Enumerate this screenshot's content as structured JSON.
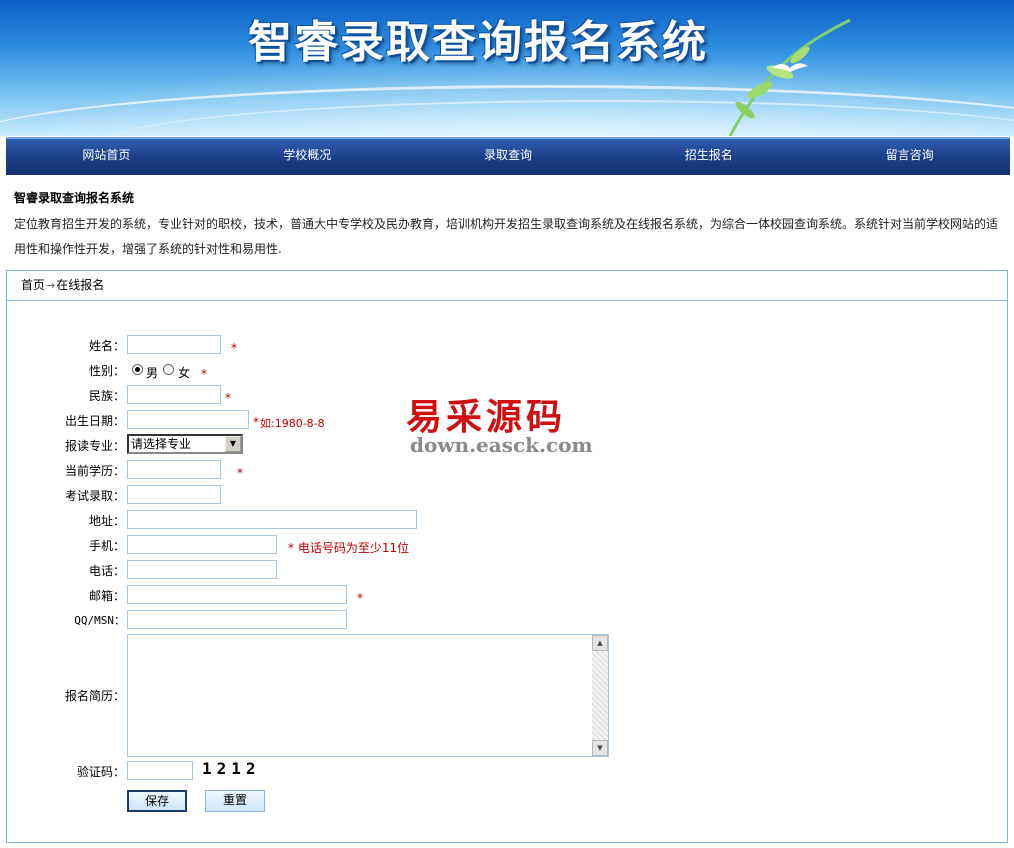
{
  "header": {
    "title": "智睿录取查询报名系统"
  },
  "nav": {
    "items": [
      {
        "label": "网站首页"
      },
      {
        "label": "学校概况"
      },
      {
        "label": "录取查询"
      },
      {
        "label": "招生报名"
      },
      {
        "label": "留言咨询"
      }
    ]
  },
  "intro": {
    "title": "智睿录取查询报名系统",
    "text": "定位教育招生开发的系统，专业针对的职校，技术，普通大中专学校及民办教育，培训机构开发招生录取查询系统及在线报名系统，为综合一体校园查询系统。系统针对当前学校网站的适用性和操作性开发，增强了系统的针对性和易用性."
  },
  "breadcrumb": {
    "home": "首页",
    "arrow": "→",
    "current": "在线报名"
  },
  "form": {
    "name_label": "姓名：",
    "gender_label": "性别：",
    "gender_male": "男",
    "gender_female": "女",
    "gender_selected": "男",
    "ethnicity_label": "民族：",
    "birthdate_label": "出生日期：",
    "birthdate_hint": "如:1980-8-8",
    "major_label": "报读专业：",
    "major_selected": "请选择专业",
    "education_label": "当前学历：",
    "exam_label": "考试录取：",
    "address_label": "地址：",
    "mobile_label": "手机：",
    "mobile_hint": "* 电话号码为至少11位",
    "phone_label": "电话：",
    "email_label": "邮箱：",
    "qq_label": "QQ/MSN：",
    "resume_label": "报名简历：",
    "captcha_label": "验证码：",
    "captcha_value": "1212",
    "required_mark": "*",
    "save_label": "保存",
    "reset_label": "重置"
  },
  "watermark": {
    "main": "易采源码",
    "sub": "down.easck.com"
  },
  "colors": {
    "nav_bg": "#1c3f8a",
    "border": "#7fb2e0",
    "required": "#c00000"
  }
}
